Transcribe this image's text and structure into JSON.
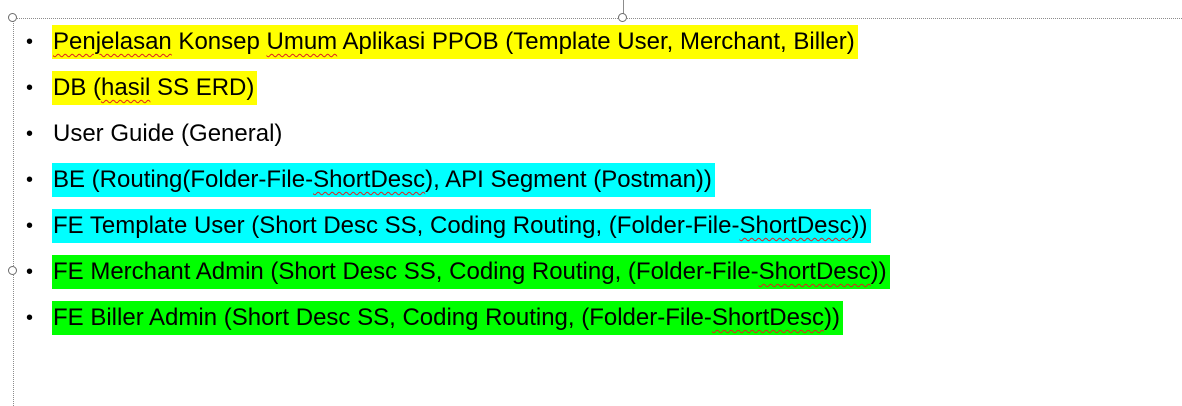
{
  "colors": {
    "yellow": "#ffff00",
    "cyan": "#00ffff",
    "green": "#00ff00",
    "spellcheck": "#e02020"
  },
  "bullets": [
    {
      "segments": [
        {
          "t": "Penjelasan",
          "spell": true
        },
        {
          "t": " Konsep "
        },
        {
          "t": "Umum",
          "spell": true
        },
        {
          "t": " Aplikasi PPOB (Template User, Merchant, Biller)"
        }
      ],
      "highlight": "yellow"
    },
    {
      "segments": [
        {
          "t": "DB ("
        },
        {
          "t": "hasil",
          "spell": true
        },
        {
          "t": " SS ERD)"
        }
      ],
      "highlight": "yellow"
    },
    {
      "segments": [
        {
          "t": "User Guide (General)"
        }
      ],
      "highlight": ""
    },
    {
      "segments": [
        {
          "t": "BE (Routing(Folder-File-"
        },
        {
          "t": "ShortDesc",
          "spell": true
        },
        {
          "t": "), API Segment (Postman))"
        }
      ],
      "highlight": "cyan"
    },
    {
      "segments": [
        {
          "t": "FE Template User (Short Desc SS, Coding Routing, (Folder-File-"
        },
        {
          "t": "ShortDesc",
          "spell": true
        },
        {
          "t": "))"
        }
      ],
      "highlight": "cyan"
    },
    {
      "segments": [
        {
          "t": "FE Merchant Admin (Short Desc SS, Coding Routing, (Folder-File-"
        },
        {
          "t": "ShortDesc",
          "spell": true
        },
        {
          "t": "))"
        }
      ],
      "highlight": "green"
    },
    {
      "segments": [
        {
          "t": "FE Biller Admin (Short Desc SS, Coding Routing, (Folder-File-"
        },
        {
          "t": "ShortDesc",
          "spell": true
        },
        {
          "t": "))"
        }
      ],
      "highlight": "green"
    }
  ],
  "bullet_glyph": "•"
}
